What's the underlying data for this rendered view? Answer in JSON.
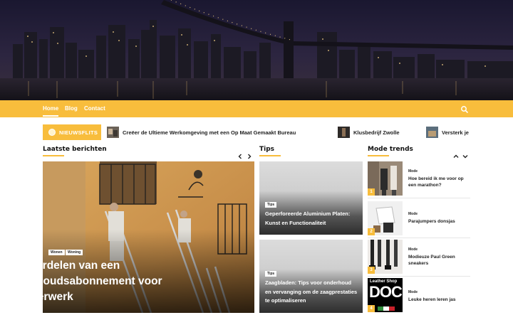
{
  "nav": {
    "items": [
      {
        "label": "Home",
        "active": true
      },
      {
        "label": "Blog",
        "active": false
      },
      {
        "label": "Contact",
        "active": false
      }
    ],
    "search_icon": "search-icon",
    "accent": "#f8bd3c"
  },
  "ticker": {
    "badge": "NIEUWSFLITS",
    "items": [
      {
        "title": "Creëer de Ultieme Werkomgeving met een Op Maat Gemaakt Bureau"
      },
      {
        "title": "Klusbedrijf Zwolle"
      },
      {
        "title": "Versterk je"
      }
    ]
  },
  "latest": {
    "heading": "Laatste berichten",
    "featured": {
      "tags": [
        "Wonen",
        "Woning"
      ],
      "title": "De voordelen van een onderhoudsabonnement voor schilderwerk"
    }
  },
  "tips": {
    "heading": "Tips",
    "items": [
      {
        "tag": "Tips",
        "title": "Geperforeerde Aluminium Platen: Kunst en Functionaliteit"
      },
      {
        "tag": "Tips",
        "title": "Zaagbladen: Tips voor onderhoud en vervanging om de zaagprestaties te optimaliseren"
      }
    ]
  },
  "trends": {
    "heading": "Mode trends",
    "items": [
      {
        "num": "1",
        "category": "Mode",
        "title": "Hoe bereid ik me voor op een marathon?"
      },
      {
        "num": "2",
        "category": "Mode",
        "title": "Parajumpers donsjas"
      },
      {
        "num": "3",
        "category": "Mode",
        "title": "Modieuze Paul Green sneakers"
      },
      {
        "num": "4",
        "category": "Mode",
        "title": "Leuke heren leren jas",
        "image_text_1": "Leather Shop",
        "image_text_2": "DOCI"
      }
    ]
  }
}
